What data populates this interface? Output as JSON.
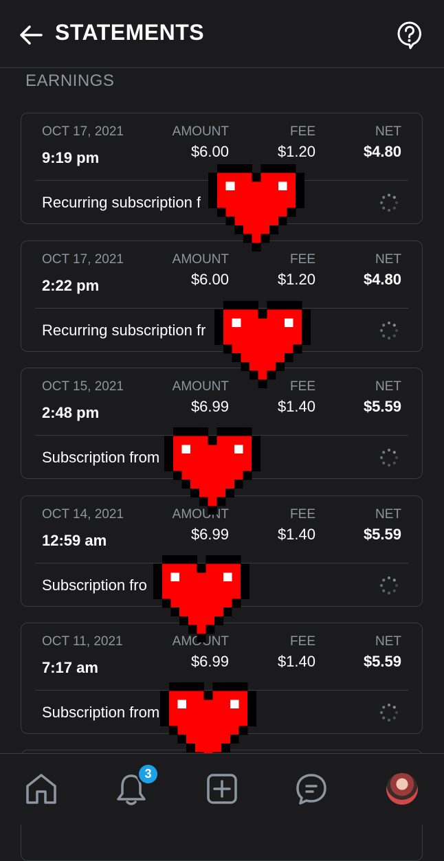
{
  "header": {
    "title": "STATEMENTS",
    "back_icon": "arrow-left-icon",
    "help_icon": "question-bubble-icon"
  },
  "section": {
    "label": "EARNINGS"
  },
  "column_headers": {
    "amount": "AMOUNT",
    "fee": "FEE",
    "net": "NET"
  },
  "statements": [
    {
      "date": "OCT 17, 2021",
      "time": "9:19 pm",
      "amount": "$6.00",
      "fee": "$1.20",
      "net": "$4.80",
      "description": "Recurring subscription f"
    },
    {
      "date": "OCT 17, 2021",
      "time": "2:22 pm",
      "amount": "$6.00",
      "fee": "$1.20",
      "net": "$4.80",
      "description": "Recurring subscription fr"
    },
    {
      "date": "OCT 15, 2021",
      "time": "2:48 pm",
      "amount": "$6.99",
      "fee": "$1.40",
      "net": "$5.59",
      "description": "Subscription from"
    },
    {
      "date": "OCT 14, 2021",
      "time": "12:59 am",
      "amount": "$6.99",
      "fee": "$1.40",
      "net": "$5.59",
      "description": "Subscription fro"
    },
    {
      "date": "OCT 11, 2021",
      "time": "7:17 am",
      "amount": "$6.99",
      "fee": "$1.40",
      "net": "$5.59",
      "description": "Subscription from"
    }
  ],
  "bottom_nav": {
    "items": [
      "home-icon",
      "bell-icon",
      "plus-square-icon",
      "message-icon",
      "avatar"
    ],
    "notification_count": "3",
    "badge_color": "#1da1e6"
  },
  "colors": {
    "background": "#1b1b1d",
    "border": "#3a3b3e",
    "muted_text": "#8b96a1",
    "heart_red": "#ff0000"
  }
}
